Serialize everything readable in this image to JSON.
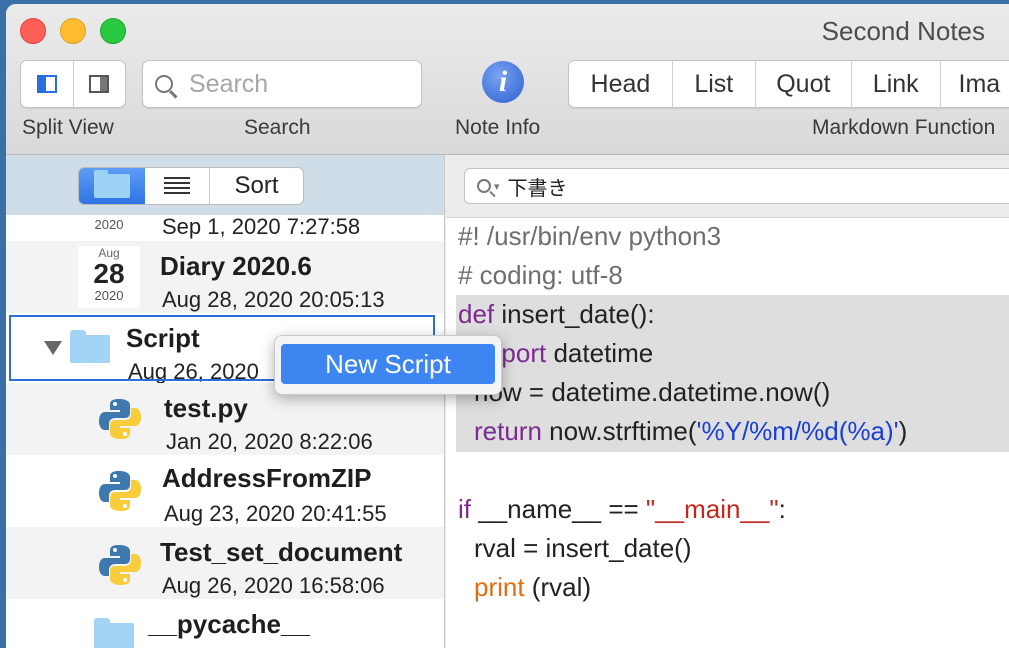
{
  "window": {
    "title": "Second Notes"
  },
  "toolbar": {
    "search_placeholder": "Search",
    "info_glyph": "i",
    "markdown_buttons": [
      "Head",
      "List",
      "Quot",
      "Link",
      "Ima"
    ],
    "labels": {
      "split_view": "Split View",
      "search": "Search",
      "note_info": "Note Info",
      "markdown": "Markdown Function"
    }
  },
  "sidebar": {
    "sort_label": "Sort",
    "items": [
      {
        "cal_year": "2020",
        "date": "Sep 1, 2020 7:27:58"
      },
      {
        "cal_month": "Aug",
        "cal_day": "28",
        "cal_year": "2020",
        "title": "Diary 2020.6",
        "date": "Aug 28, 2020 20:05:13"
      },
      {
        "title": "Script",
        "date": "Aug 26, 2020"
      },
      {
        "title": "test.py",
        "date": "Jan 20, 2020 8:22:06"
      },
      {
        "title": "AddressFromZIP",
        "date": "Aug 23, 2020 20:41:55"
      },
      {
        "title": "Test_set_document",
        "date": "Aug 26, 2020 16:58:06"
      },
      {
        "title": "__pycache__",
        "date": ""
      }
    ]
  },
  "editor": {
    "find_value": "下書き",
    "code": {
      "l1": "#! /usr/bin/env python3",
      "l2": "# coding: utf-8",
      "l3_kw": "def",
      "l3_rest": " insert_date():",
      "l4_kw": "import",
      "l4_rest": " datetime",
      "l5": "now = datetime.datetime.now()",
      "l6_kw": "return",
      "l6_mid": " now.strftime(",
      "l6_str": "'%Y/%m/%d(%a)'",
      "l6_end": ")",
      "l8_kw": "if",
      "l8_mid": " __name__ == ",
      "l8_str": "\"__main__\"",
      "l8_end": ":",
      "l9": "rval = insert_date()",
      "l10_kw": "print",
      "l10_rest": " (rval)"
    }
  },
  "context_menu": {
    "item": "New Script"
  }
}
